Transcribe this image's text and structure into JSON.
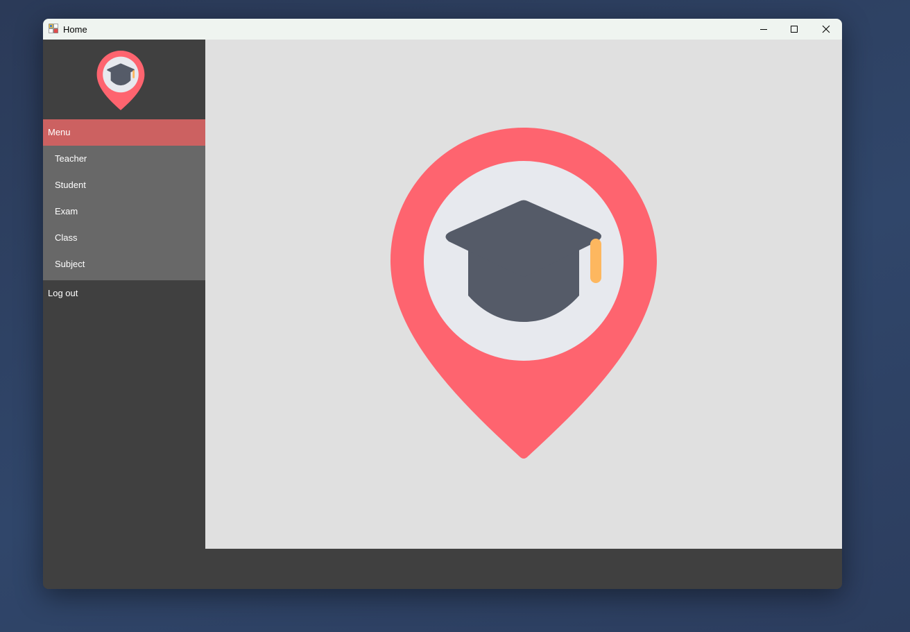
{
  "window": {
    "title": "Home"
  },
  "sidebar": {
    "menu_label": "Menu",
    "items": [
      {
        "label": "Teacher"
      },
      {
        "label": "Student"
      },
      {
        "label": "Exam"
      },
      {
        "label": "Class"
      },
      {
        "label": "Subject"
      }
    ],
    "logout_label": "Log out"
  },
  "icons": {
    "app": "application-icon",
    "logo": "graduation-cap-location-pin-icon",
    "minimize": "minimize-icon",
    "maximize": "maximize-icon",
    "close": "close-icon"
  },
  "colors": {
    "menu_header": "#cc6161",
    "pin": "#fe646f",
    "cap": "#555b68",
    "tassel": "#fdb75f",
    "pin_inner": "#e7e9ee",
    "sidebar": "#404040",
    "submenu": "#686868",
    "main_bg": "#e0e0e0"
  }
}
